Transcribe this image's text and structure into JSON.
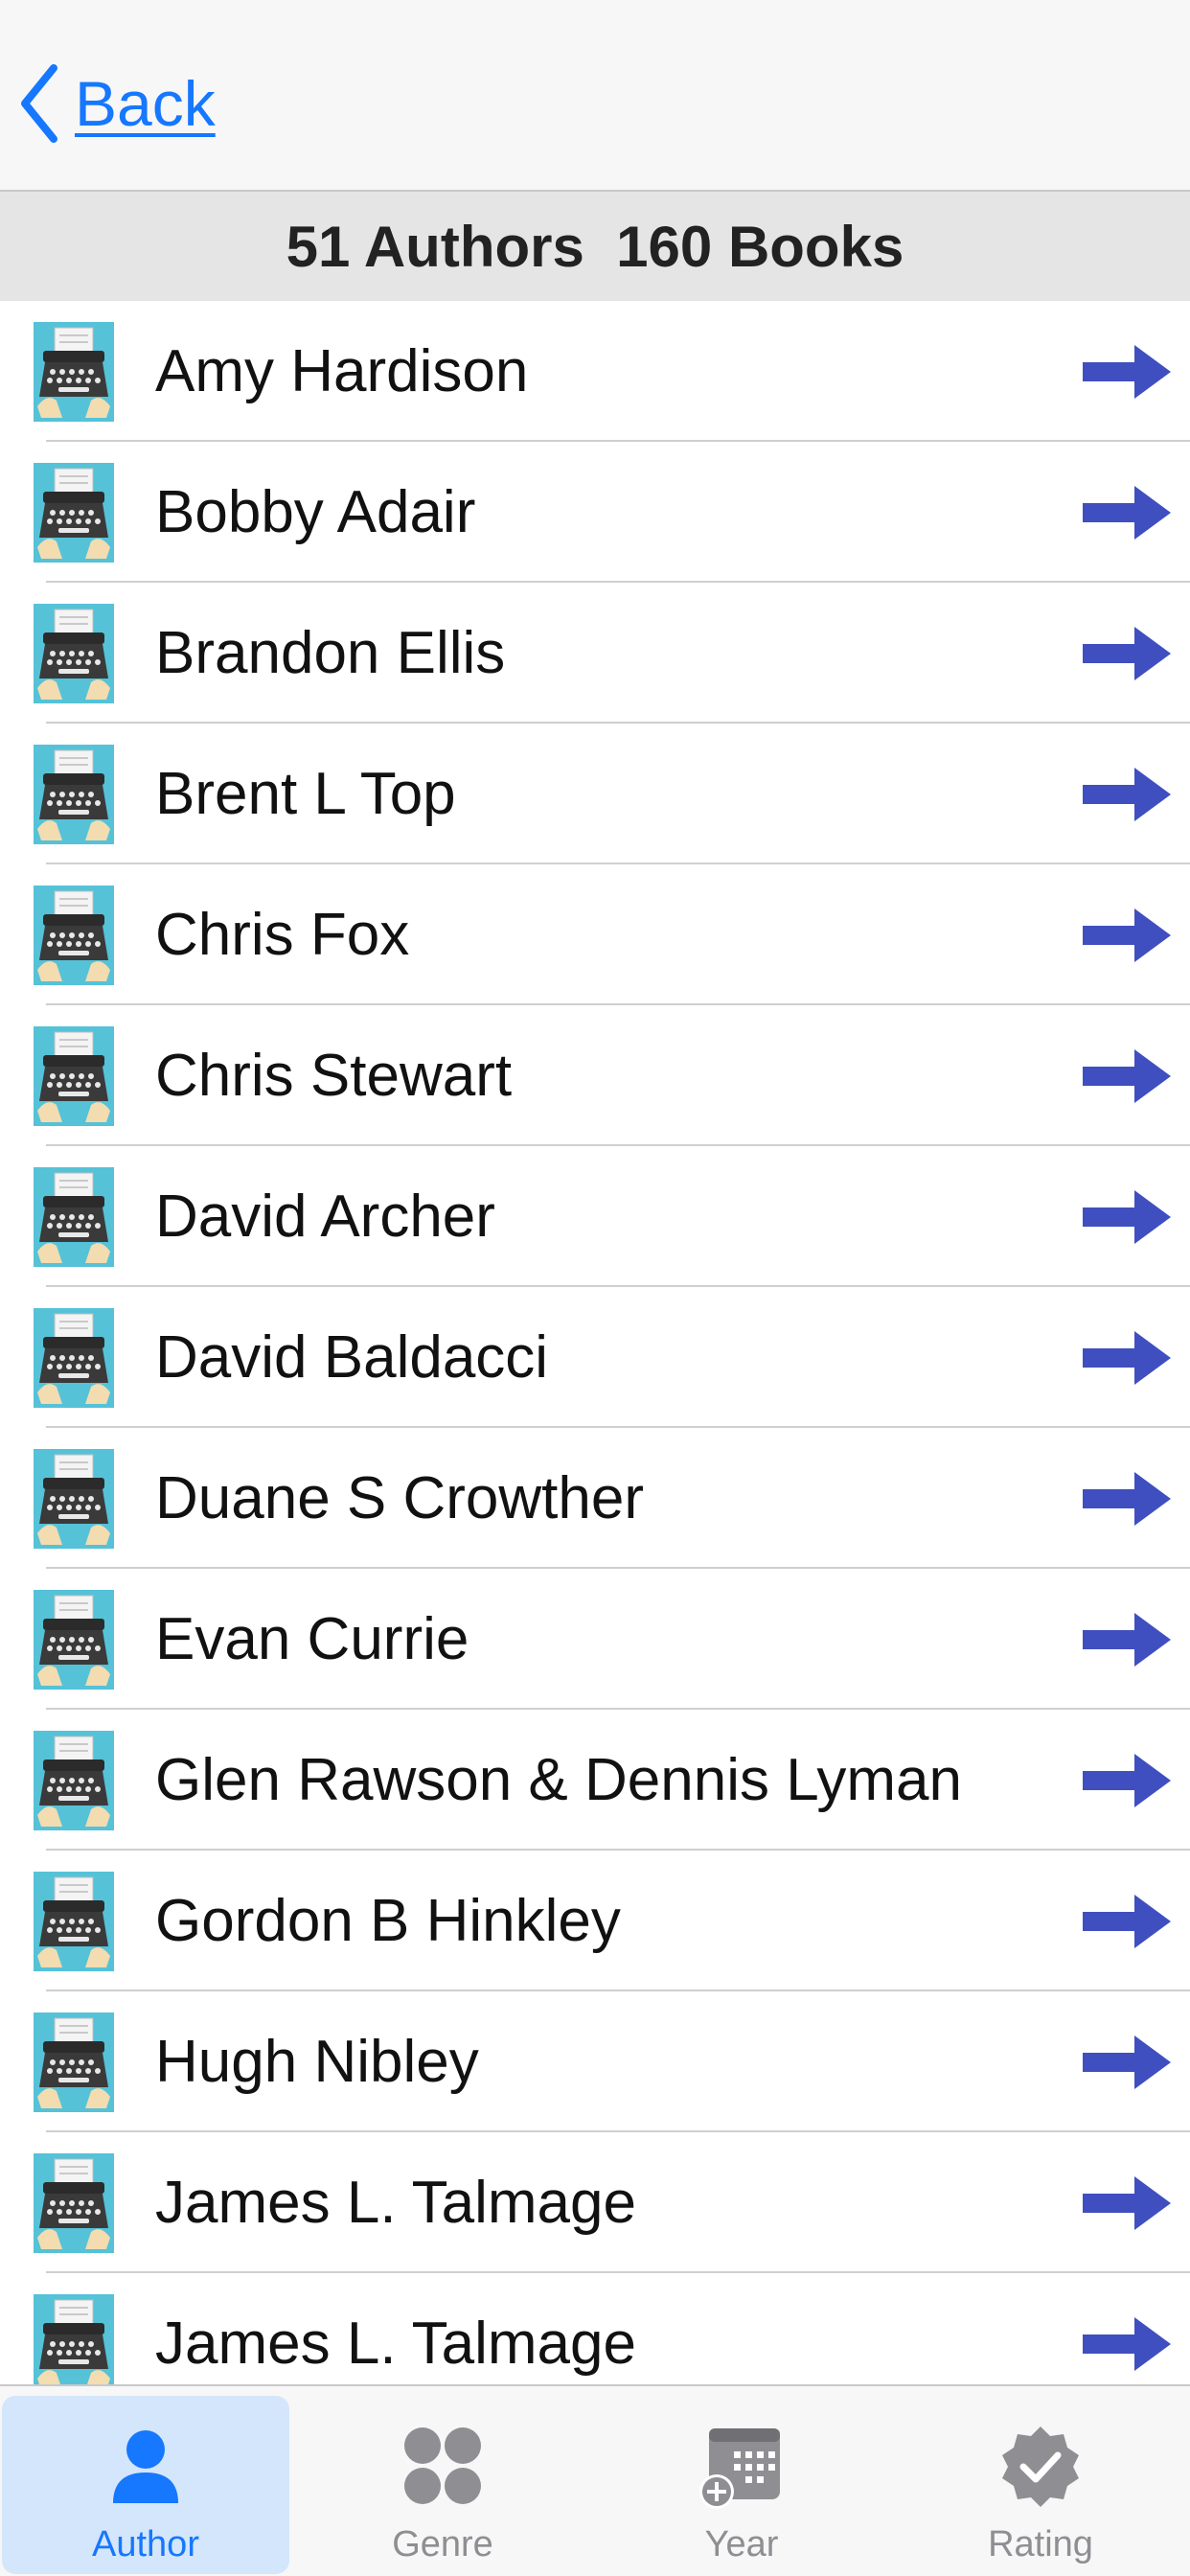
{
  "nav": {
    "back_label": "Back"
  },
  "summary": {
    "text": "51 Authors  160 Books"
  },
  "authors": [
    "Amy Hardison",
    "Bobby Adair",
    "Brandon Ellis",
    "Brent L Top",
    "Chris Fox",
    "Chris Stewart",
    "David Archer",
    "David Baldacci",
    "Duane S Crowther",
    "Evan Currie",
    "Glen Rawson & Dennis Lyman",
    "Gordon B Hinkley",
    "Hugh Nibley",
    "James L. Talmage",
    "James L. Talmage"
  ],
  "tabs": [
    {
      "label": "Author",
      "icon": "person-icon",
      "active": true
    },
    {
      "label": "Genre",
      "icon": "four-dots-icon",
      "active": false
    },
    {
      "label": "Year",
      "icon": "calendar-add-icon",
      "active": false
    },
    {
      "label": "Rating",
      "icon": "checkmark-badge-icon",
      "active": false
    }
  ],
  "colors": {
    "accent": "#1677ff",
    "arrow": "#3f4fc0",
    "tab_active_bg": "#d4e6fb",
    "tab_inactive": "#8e8e93",
    "header_bg": "#e5e5e5",
    "thumb_bg": "#55c2d8"
  }
}
